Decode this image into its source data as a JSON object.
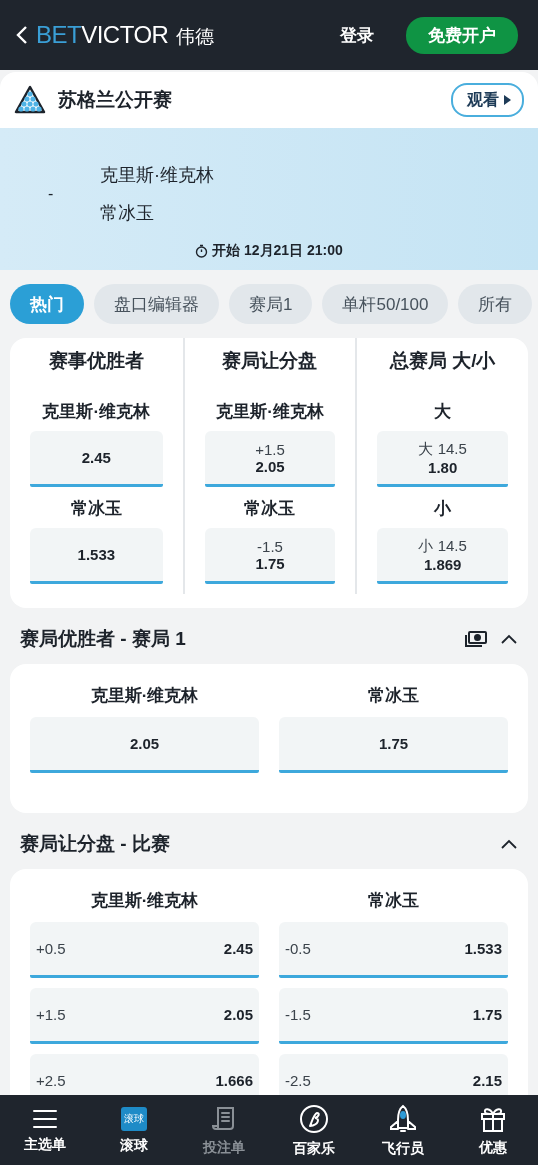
{
  "header": {
    "logo": {
      "bet": "BET",
      "victor": "VICTOR",
      "cn": "伟德"
    },
    "login": "登录",
    "register": "免费开户"
  },
  "event": {
    "title": "苏格兰公开赛",
    "watch": "观看",
    "separator": "-",
    "teams": [
      "克里斯·维克林",
      "常冰玉"
    ],
    "start": "开始 12月21日 21:00"
  },
  "tabs": [
    {
      "label": "热门",
      "selected": true
    },
    {
      "label": "盘口编辑器",
      "selected": false
    },
    {
      "label": "赛局1",
      "selected": false
    },
    {
      "label": "单杆50/100",
      "selected": false
    },
    {
      "label": "所有",
      "selected": false
    }
  ],
  "featured": [
    {
      "title": "赛事优胜者",
      "selections": [
        {
          "name": "克里斯·维克林",
          "odds": "2.45"
        },
        {
          "name": "常冰玉",
          "odds": "1.533"
        }
      ]
    },
    {
      "title": "赛局让分盘",
      "selections": [
        {
          "name": "克里斯·维克林",
          "line": "+1.5",
          "odds": "2.05"
        },
        {
          "name": "常冰玉",
          "line": "-1.5",
          "odds": "1.75"
        }
      ]
    },
    {
      "title": "总赛局 大/小",
      "selections": [
        {
          "name": "大",
          "line": "大 14.5",
          "odds": "1.80"
        },
        {
          "name": "小",
          "line": "小 14.5",
          "odds": "1.869"
        }
      ]
    }
  ],
  "sections": [
    {
      "kind": "two-way",
      "title": "赛局优胜者 - 赛局 1",
      "cash_out": true,
      "expanded": true,
      "columns": [
        "克里斯·维克林",
        "常冰玉"
      ],
      "rows": [
        [
          {
            "odds": "2.05"
          },
          {
            "odds": "1.75"
          }
        ]
      ]
    },
    {
      "kind": "handicap",
      "title": "赛局让分盘 - 比赛",
      "cash_out": false,
      "expanded": true,
      "columns": [
        "克里斯·维克林",
        "常冰玉"
      ],
      "rows": [
        [
          {
            "line": "+0.5",
            "odds": "2.45"
          },
          {
            "line": "-0.5",
            "odds": "1.533"
          }
        ],
        [
          {
            "line": "+1.5",
            "odds": "2.05"
          },
          {
            "line": "-1.5",
            "odds": "1.75"
          }
        ],
        [
          {
            "line": "+2.5",
            "odds": "1.666"
          },
          {
            "line": "-2.5",
            "odds": "2.15"
          }
        ]
      ]
    }
  ],
  "nav": [
    {
      "kind": "menu",
      "label": "主选单",
      "disabled": false
    },
    {
      "kind": "live",
      "label": "滚球",
      "badge": "滚球",
      "disabled": false
    },
    {
      "kind": "betslip",
      "label": "投注单",
      "disabled": true
    },
    {
      "kind": "baccarat",
      "label": "百家乐",
      "disabled": false
    },
    {
      "kind": "rocket",
      "label": "飞行员",
      "disabled": false
    },
    {
      "kind": "gift",
      "label": "优惠",
      "disabled": false
    }
  ]
}
